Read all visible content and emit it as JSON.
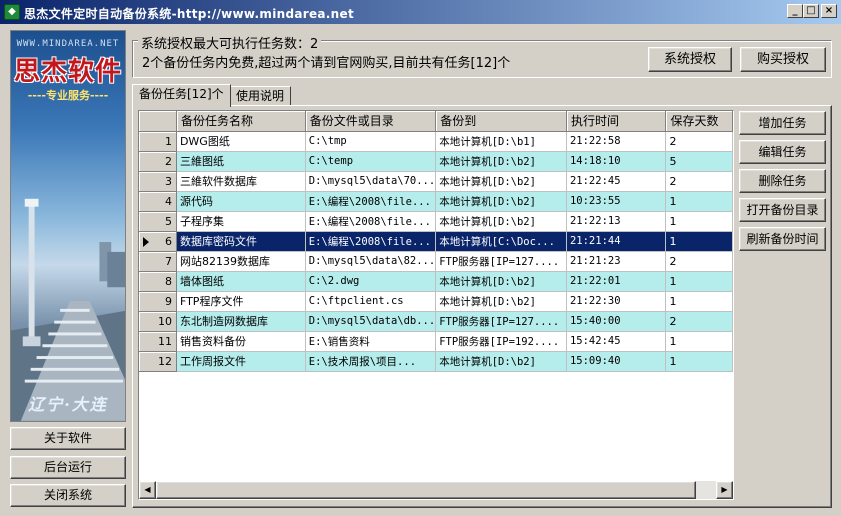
{
  "window": {
    "title": "思杰文件定时自动备份系统-http://www.mindarea.net",
    "minimize": "_",
    "maximize": "□",
    "close": "×"
  },
  "banner": {
    "url": "WWW.MINDAREA.NET",
    "brand": "思杰软件",
    "subtitle": "----专业服务----",
    "city": "辽宁·大连"
  },
  "left_buttons": [
    "关于软件",
    "后台运行",
    "关闭系统"
  ],
  "license": {
    "legend": "系统授权最大可执行任务数：2",
    "info": "2个备份任务内免费,超过两个请到官网购买,目前共有任务[12]个",
    "authorize_button": "系统授权",
    "buy_button": "购买授权"
  },
  "tabs": [
    {
      "label": "备份任务[12]个",
      "active": true
    },
    {
      "label": "使用说明",
      "active": false
    }
  ],
  "table": {
    "columns": [
      "备份任务名称",
      "备份文件或目录",
      "备份到",
      "执行时间",
      "保存天数"
    ],
    "rows": [
      {
        "idx": "1",
        "name": "DWG图纸",
        "source": "C:\\tmp",
        "target": "本地计算机[D:\\b1]",
        "time": "21:22:58",
        "days": "2"
      },
      {
        "idx": "2",
        "name": "三維图纸",
        "source": "C:\\temp",
        "target": "本地计算机[D:\\b2]",
        "time": "14:18:10",
        "days": "5"
      },
      {
        "idx": "3",
        "name": "三維软件数据库",
        "source": "D:\\mysql5\\data\\70...",
        "target": "本地计算机[D:\\b2]",
        "time": "21:22:45",
        "days": "2"
      },
      {
        "idx": "4",
        "name": "源代码",
        "source": "E:\\编程\\2008\\file...",
        "target": "本地计算机[D:\\b2]",
        "time": "10:23:55",
        "days": "1"
      },
      {
        "idx": "5",
        "name": "子程序集",
        "source": "E:\\编程\\2008\\file...",
        "target": "本地计算机[D:\\b2]",
        "time": "21:22:13",
        "days": "1"
      },
      {
        "idx": "6",
        "name": "数据库密码文件",
        "source": "E:\\编程\\2008\\file...",
        "target": "本地计算机[C:\\Doc...",
        "time": "21:21:44",
        "days": "1"
      },
      {
        "idx": "7",
        "name": "网站82139数据库",
        "source": "D:\\mysql5\\data\\82...",
        "target": "FTP服务器[IP=127....",
        "time": "21:21:23",
        "days": "2"
      },
      {
        "idx": "8",
        "name": "墙体图纸",
        "source": "C:\\2.dwg",
        "target": "本地计算机[D:\\b2]",
        "time": "21:22:01",
        "days": "1"
      },
      {
        "idx": "9",
        "name": "FTP程序文件",
        "source": "C:\\ftpclient.cs",
        "target": "本地计算机[D:\\b2]",
        "time": "21:22:30",
        "days": "1"
      },
      {
        "idx": "10",
        "name": "东北制造网数据库",
        "source": "D:\\mysql5\\data\\db...",
        "target": "FTP服务器[IP=127....",
        "time": "15:40:00",
        "days": "2"
      },
      {
        "idx": "11",
        "name": "销售资料备份",
        "source": "E:\\销售资料",
        "target": "FTP服务器[IP=192....",
        "time": "15:42:45",
        "days": "1"
      },
      {
        "idx": "12",
        "name": "工作周报文件",
        "source": "E:\\技术周报\\项目...",
        "target": "本地计算机[D:\\b2]",
        "time": "15:09:40",
        "days": "1"
      }
    ],
    "selected_row": "6"
  },
  "right_buttons": [
    "增加任务",
    "编辑任务",
    "删除任务",
    "打开备份目录",
    "刷新备份时间"
  ],
  "colors": {
    "title_gradient_start": "#0a246a",
    "row_alt": "#b5ecec",
    "row_selected": "#0a246a",
    "brand_red": "#c1181e"
  }
}
